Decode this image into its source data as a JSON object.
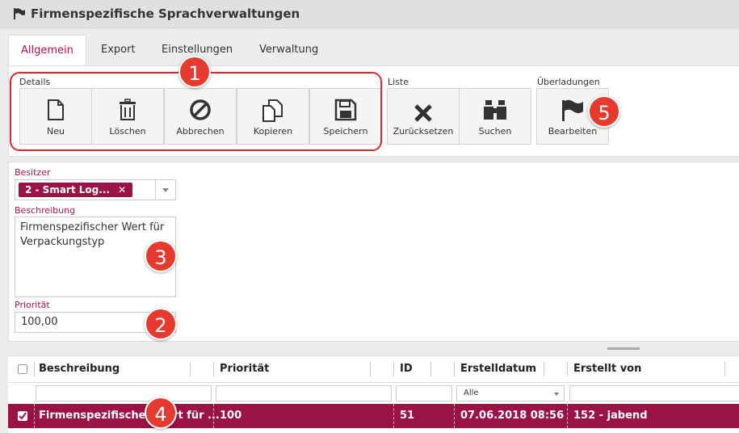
{
  "window": {
    "title": "Firmenspezifische Sprachverwaltungen"
  },
  "tabs": [
    "Allgemein",
    "Export",
    "Einstellungen",
    "Verwaltung"
  ],
  "active_tab": "Allgemein",
  "toolbar": {
    "details": {
      "label": "Details",
      "buttons": [
        "Neu",
        "Löschen",
        "Abbrechen",
        "Kopieren",
        "Speichern"
      ]
    },
    "liste": {
      "label": "Liste",
      "buttons": [
        "Zurücksetzen",
        "Suchen"
      ]
    },
    "ueberladungen": {
      "label": "Überladungen",
      "buttons": [
        "Bearbeiten"
      ]
    }
  },
  "form": {
    "besitzer": {
      "label": "Besitzer",
      "value": "2 - Smart Log...",
      "remove": "✕"
    },
    "beschreibung": {
      "label": "Beschreibung",
      "value": "Firmenspezifischer Wert für Verpackungstyp"
    },
    "prioritaet": {
      "label": "Priorität",
      "value": "100,00"
    }
  },
  "grid": {
    "columns": [
      "Beschreibung",
      "Priorität",
      "ID",
      "Erstelldatum",
      "Erstellt von"
    ],
    "filter": {
      "erstelldatum": "Alle"
    },
    "rows": [
      {
        "beschreibung": "Firmenspezifischer Wert für ...",
        "prioritaet": "100",
        "id": "51",
        "erstelldatum": "07.06.2018 08:56",
        "erstellt_von": "152 - jabend",
        "selected": true
      }
    ]
  },
  "callouts": [
    "1",
    "2",
    "3",
    "4",
    "5"
  ],
  "colors": {
    "accent": "#b0124a",
    "selected_row": "#9b1245",
    "callout": "#e63a2e"
  },
  "icons": [
    "flag-icon",
    "file-icon",
    "trash-icon",
    "cancel-icon",
    "copy-icon",
    "save-icon",
    "x-icon",
    "binoculars-icon"
  ]
}
